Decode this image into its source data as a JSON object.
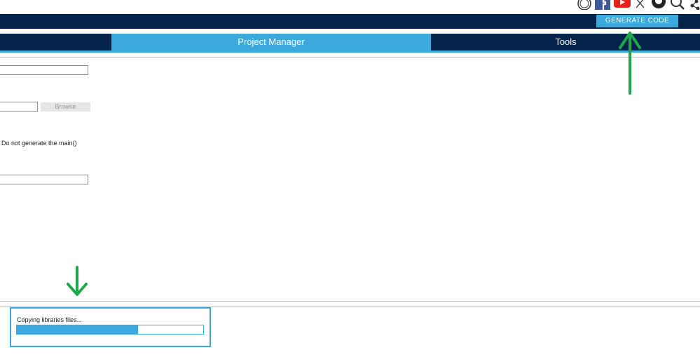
{
  "header": {
    "generate_code_label": "GENERATE CODE"
  },
  "social_icons": [
    "st-logo-icon",
    "facebook-icon",
    "youtube-icon",
    "x-icon",
    "github-icon",
    "search-icon",
    "share-icon"
  ],
  "tabs": [
    {
      "label": ""
    },
    {
      "label": "Project Manager",
      "active": true
    },
    {
      "label": "Tools"
    }
  ],
  "form": {
    "browse_label": "Browse",
    "main_option_label": "Do not generate the main()"
  },
  "progress": {
    "label": "Copying libraries files...",
    "fraction": 0.65
  },
  "colors": {
    "dark_blue": "#03234b",
    "accent_blue": "#3ca9dc",
    "annotation_green": "#1fa84a"
  }
}
